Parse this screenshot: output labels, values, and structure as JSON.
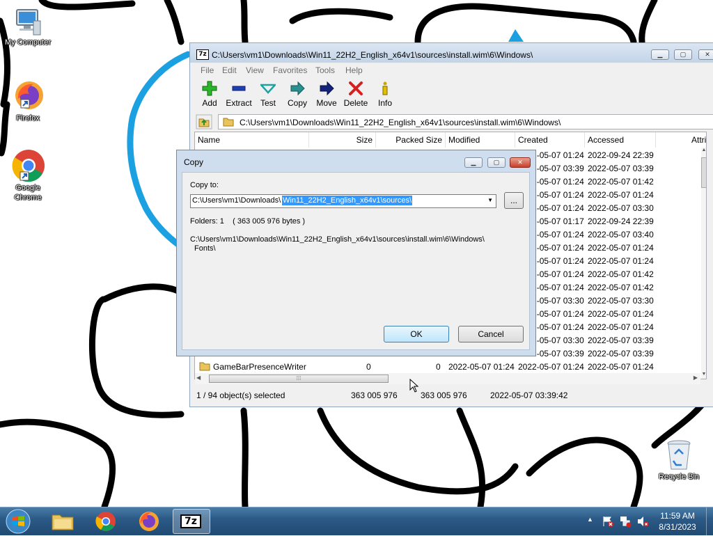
{
  "desktop": {
    "icons": [
      {
        "label": "My Computer"
      },
      {
        "label": "Firefox"
      },
      {
        "label": "Google Chrome"
      },
      {
        "label": "Recycle Bin"
      }
    ]
  },
  "main_window": {
    "title": "C:\\Users\\vm1\\Downloads\\Win11_22H2_English_x64v1\\sources\\install.wim\\6\\Windows\\",
    "app_icon_text": "7z",
    "menu": [
      "File",
      "Edit",
      "View",
      "Favorites",
      "Tools",
      "Help"
    ],
    "toolbar": [
      "Add",
      "Extract",
      "Test",
      "Copy",
      "Move",
      "Delete",
      "Info"
    ],
    "address": "C:\\Users\\vm1\\Downloads\\Win11_22H2_English_x64v1\\sources\\install.wim\\6\\Windows\\",
    "columns": [
      "Name",
      "Size",
      "Packed Size",
      "Modified",
      "Created",
      "Accessed",
      "Attrib"
    ],
    "rows": [
      {
        "created": "2022-05-07 01:24",
        "accessed": "2022-09-24 22:39"
      },
      {
        "created": "2022-05-07 03:39",
        "accessed": "2022-05-07 03:39"
      },
      {
        "created": "2022-05-07 01:24",
        "accessed": "2022-05-07 01:42"
      },
      {
        "created": "2022-05-07 01:24",
        "accessed": "2022-05-07 01:24"
      },
      {
        "created": "2022-05-07 01:24",
        "accessed": "2022-05-07 03:30"
      },
      {
        "created": "2022-05-07 01:17",
        "accessed": "2022-09-24 22:39"
      },
      {
        "created": "2022-05-07 01:24",
        "accessed": "2022-05-07 03:40"
      },
      {
        "created": "2022-05-07 01:24",
        "accessed": "2022-05-07 01:24"
      },
      {
        "created": "2022-05-07 01:24",
        "accessed": "2022-05-07 01:24"
      },
      {
        "created": "2022-05-07 01:24",
        "accessed": "2022-05-07 01:42"
      },
      {
        "created": "2022-05-07 01:24",
        "accessed": "2022-05-07 01:42"
      },
      {
        "created": "2022-05-07 03:30",
        "accessed": "2022-05-07 03:30"
      },
      {
        "created": "2022-05-07 01:24",
        "accessed": "2022-05-07 01:24"
      },
      {
        "created": "2022-05-07 01:24",
        "accessed": "2022-05-07 01:24"
      },
      {
        "created": "2022-05-07 03:30",
        "accessed": "2022-05-07 03:39"
      },
      {
        "created": "2022-05-07 03:39",
        "accessed": "2022-05-07 03:39"
      },
      {
        "name": "GameBarPresenceWriter",
        "size": "0",
        "packed": "0",
        "modified": "2022-05-07 01:24",
        "created": "2022-05-07 01:24",
        "accessed": "2022-05-07 01:24"
      }
    ],
    "status": {
      "selected": "1 / 94 object(s) selected",
      "size": "363 005 976",
      "packed": "363 005 976",
      "modified": "2022-05-07 03:39:42"
    }
  },
  "copy_dialog": {
    "title": "Copy",
    "copy_to_label": "Copy to:",
    "path_prefix": "C:\\Users\\vm1\\Downloads\\",
    "path_selected": "Win11_22H2_English_x64v1\\sources\\",
    "browse_label": "...",
    "folders_info": "Folders: 1    ( 363 005 976 bytes )",
    "source_line1": "C:\\Users\\vm1\\Downloads\\Win11_22H2_English_x64v1\\sources\\install.wim\\6\\Windows\\",
    "source_line2": "Fonts\\",
    "ok_label": "OK",
    "cancel_label": "Cancel"
  },
  "taskbar": {
    "time": "11:59 AM",
    "date": "8/31/2023",
    "app_7z_label": "7z"
  },
  "colors": {
    "selection": "#3399ff",
    "taskbar": "#2c5a86",
    "wallpaper_stroke": "#000000",
    "wallpaper_blue": "#1ba1e2"
  }
}
